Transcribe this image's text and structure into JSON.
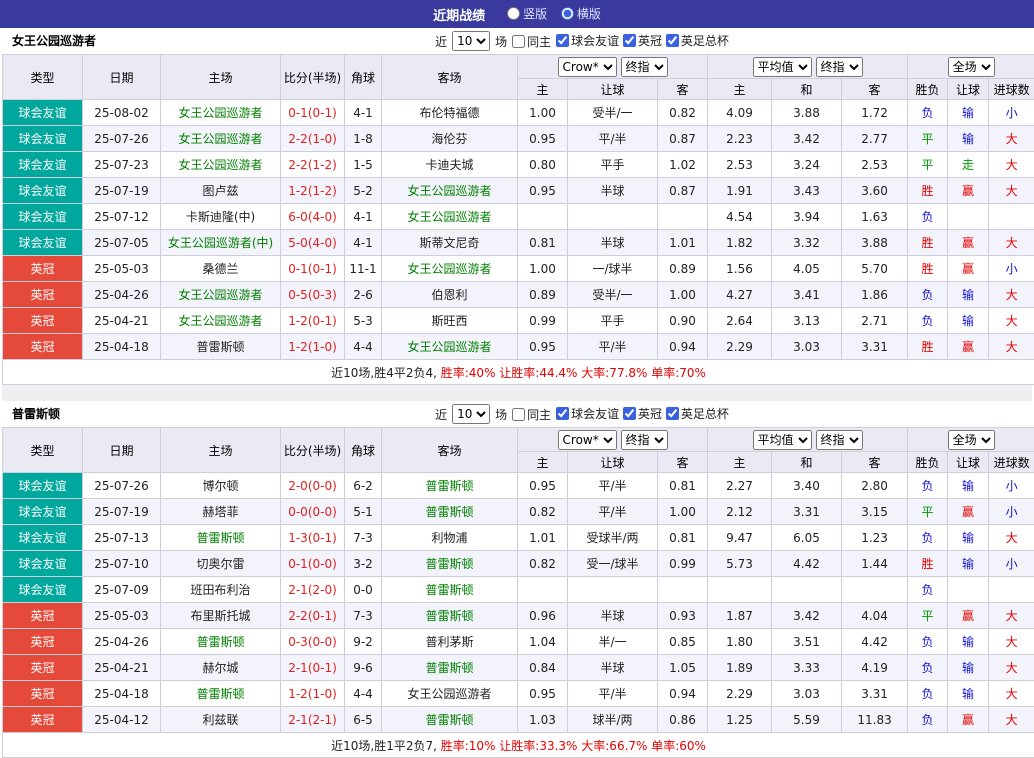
{
  "topbar": {
    "title": "近期战绩",
    "radios": [
      {
        "label": "竖版",
        "checked": false
      },
      {
        "label": "横版",
        "checked": true
      }
    ]
  },
  "filter": {
    "near": "近",
    "count": "10",
    "matches": "场",
    "same_home": "同主",
    "same_home_checked": false,
    "leagues": [
      {
        "label": "球会友谊",
        "checked": true
      },
      {
        "label": "英冠",
        "checked": true
      },
      {
        "label": "英足总杯",
        "checked": true
      }
    ]
  },
  "header": {
    "type": "类型",
    "date": "日期",
    "home": "主场",
    "score": "比分(半场)",
    "corner": "角球",
    "away": "客场",
    "odds_source": "Crow*",
    "odds_kind": "终指",
    "avg_source": "平均值",
    "avg_kind": "终指",
    "full_source": "全场",
    "sub": [
      "主",
      "让球",
      "客",
      "主",
      "和",
      "客",
      "胜负",
      "让球",
      "进球数"
    ]
  },
  "colors": {
    "topbar_bg": "#3A3A9E",
    "friendly_badge": "#00A79D",
    "league_badge": "#E5493A",
    "focal_team": "#008000",
    "win": "#E60000",
    "loss": "#1414CC",
    "draw": "#009900"
  },
  "sections": [
    {
      "team": "女王公园巡游者",
      "rows": [
        {
          "type": "球会友谊",
          "type_key": "friendly",
          "date": "25-08-02",
          "home": "女王公园巡游者",
          "home_key": "focal",
          "score": "0-1(0-1)",
          "corners": "4-1",
          "away": "布伦特福德",
          "away_key": "",
          "odds_home": "1.00",
          "handicap": "受半/一",
          "odds_away": "0.82",
          "avg_home": "4.09",
          "avg_draw": "3.88",
          "avg_away": "1.72",
          "result": "负",
          "result_color": "blue",
          "handicap_result": "输",
          "handicap_color": "blue",
          "goals_result": "小",
          "goals_color": "blue"
        },
        {
          "type": "球会友谊",
          "type_key": "friendly",
          "date": "25-07-26",
          "home": "女王公园巡游者",
          "home_key": "focal",
          "score": "2-2(1-0)",
          "corners": "1-8",
          "away": "海伦芬",
          "away_key": "",
          "odds_home": "0.95",
          "handicap": "平/半",
          "odds_away": "0.87",
          "avg_home": "2.23",
          "avg_draw": "3.42",
          "avg_away": "2.77",
          "result": "平",
          "result_color": "green",
          "handicap_result": "输",
          "handicap_color": "blue",
          "goals_result": "大",
          "goals_color": "red"
        },
        {
          "type": "球会友谊",
          "type_key": "friendly",
          "date": "25-07-23",
          "home": "女王公园巡游者",
          "home_key": "focal",
          "score": "2-2(1-2)",
          "corners": "1-5",
          "away": "卡迪夫城",
          "away_key": "",
          "odds_home": "0.80",
          "handicap": "平手",
          "odds_away": "1.02",
          "avg_home": "2.53",
          "avg_draw": "3.24",
          "avg_away": "2.53",
          "result": "平",
          "result_color": "green",
          "handicap_result": "走",
          "handicap_color": "green",
          "goals_result": "大",
          "goals_color": "red"
        },
        {
          "type": "球会友谊",
          "type_key": "friendly",
          "date": "25-07-19",
          "home": "图卢兹",
          "home_key": "",
          "score": "1-2(1-2)",
          "corners": "5-2",
          "away": "女王公园巡游者",
          "away_key": "focal",
          "odds_home": "0.95",
          "handicap": "半球",
          "odds_away": "0.87",
          "avg_home": "1.91",
          "avg_draw": "3.43",
          "avg_away": "3.60",
          "result": "胜",
          "result_color": "red",
          "handicap_result": "赢",
          "handicap_color": "red",
          "goals_result": "大",
          "goals_color": "red"
        },
        {
          "type": "球会友谊",
          "type_key": "friendly",
          "date": "25-07-12",
          "home": "卡斯迪隆(中)",
          "home_key": "",
          "score": "6-0(4-0)",
          "corners": "4-1",
          "away": "女王公园巡游者",
          "away_key": "focal",
          "odds_home": "",
          "handicap": "",
          "odds_away": "",
          "avg_home": "4.54",
          "avg_draw": "3.94",
          "avg_away": "1.63",
          "result": "负",
          "result_color": "blue",
          "handicap_result": "",
          "handicap_color": "",
          "goals_result": "",
          "goals_color": ""
        },
        {
          "type": "球会友谊",
          "type_key": "friendly",
          "date": "25-07-05",
          "home": "女王公园巡游者(中)",
          "home_key": "focal",
          "score": "5-0(4-0)",
          "corners": "4-1",
          "away": "斯蒂文尼奇",
          "away_key": "",
          "odds_home": "0.81",
          "handicap": "半球",
          "odds_away": "1.01",
          "avg_home": "1.82",
          "avg_draw": "3.32",
          "avg_away": "3.88",
          "result": "胜",
          "result_color": "red",
          "handicap_result": "赢",
          "handicap_color": "red",
          "goals_result": "大",
          "goals_color": "red"
        },
        {
          "type": "英冠",
          "type_key": "league",
          "date": "25-05-03",
          "home": "桑德兰",
          "home_key": "",
          "score": "0-1(0-1)",
          "corners": "11-1",
          "away": "女王公园巡游者",
          "away_key": "focal",
          "odds_home": "1.00",
          "handicap": "一/球半",
          "odds_away": "0.89",
          "avg_home": "1.56",
          "avg_draw": "4.05",
          "avg_away": "5.70",
          "result": "胜",
          "result_color": "red",
          "handicap_result": "赢",
          "handicap_color": "red",
          "goals_result": "小",
          "goals_color": "blue"
        },
        {
          "type": "英冠",
          "type_key": "league",
          "date": "25-04-26",
          "home": "女王公园巡游者",
          "home_key": "focal",
          "score": "0-5(0-3)",
          "corners": "2-6",
          "away": "伯恩利",
          "away_key": "",
          "odds_home": "0.89",
          "handicap": "受半/一",
          "odds_away": "1.00",
          "avg_home": "4.27",
          "avg_draw": "3.41",
          "avg_away": "1.86",
          "result": "负",
          "result_color": "blue",
          "handicap_result": "输",
          "handicap_color": "blue",
          "goals_result": "大",
          "goals_color": "red"
        },
        {
          "type": "英冠",
          "type_key": "league",
          "date": "25-04-21",
          "home": "女王公园巡游者",
          "home_key": "focal",
          "score": "1-2(0-1)",
          "corners": "5-3",
          "away": "斯旺西",
          "away_key": "",
          "odds_home": "0.99",
          "handicap": "平手",
          "odds_away": "0.90",
          "avg_home": "2.64",
          "avg_draw": "3.13",
          "avg_away": "2.71",
          "result": "负",
          "result_color": "blue",
          "handicap_result": "输",
          "handicap_color": "blue",
          "goals_result": "大",
          "goals_color": "red"
        },
        {
          "type": "英冠",
          "type_key": "league",
          "date": "25-04-18",
          "home": "普雷斯顿",
          "home_key": "",
          "score": "1-2(1-0)",
          "corners": "4-4",
          "away": "女王公园巡游者",
          "away_key": "focal",
          "odds_home": "0.95",
          "handicap": "平/半",
          "odds_away": "0.94",
          "avg_home": "2.29",
          "avg_draw": "3.03",
          "avg_away": "3.31",
          "result": "胜",
          "result_color": "red",
          "handicap_result": "赢",
          "handicap_color": "red",
          "goals_result": "大",
          "goals_color": "red"
        }
      ],
      "summary": {
        "record": "近10场,胜4平2负4,",
        "stats": " 胜率:40% 让胜率:44.4% 大率:77.8% 单率:70%"
      }
    },
    {
      "team": "普雷斯顿",
      "rows": [
        {
          "type": "球会友谊",
          "type_key": "friendly",
          "date": "25-07-26",
          "home": "博尔顿",
          "home_key": "",
          "score": "2-0(0-0)",
          "corners": "6-2",
          "away": "普雷斯顿",
          "away_key": "focal",
          "odds_home": "0.95",
          "handicap": "平/半",
          "odds_away": "0.81",
          "avg_home": "2.27",
          "avg_draw": "3.40",
          "avg_away": "2.80",
          "result": "负",
          "result_color": "blue",
          "handicap_result": "输",
          "handicap_color": "blue",
          "goals_result": "小",
          "goals_color": "blue"
        },
        {
          "type": "球会友谊",
          "type_key": "friendly",
          "date": "25-07-19",
          "home": "赫塔菲",
          "home_key": "",
          "score": "0-0(0-0)",
          "corners": "5-1",
          "away": "普雷斯顿",
          "away_key": "focal",
          "odds_home": "0.82",
          "handicap": "平/半",
          "odds_away": "1.00",
          "avg_home": "2.12",
          "avg_draw": "3.31",
          "avg_away": "3.15",
          "result": "平",
          "result_color": "green",
          "handicap_result": "赢",
          "handicap_color": "red",
          "goals_result": "小",
          "goals_color": "blue"
        },
        {
          "type": "球会友谊",
          "type_key": "friendly",
          "date": "25-07-13",
          "home": "普雷斯顿",
          "home_key": "focal",
          "score": "1-3(0-1)",
          "corners": "7-3",
          "away": "利物浦",
          "away_key": "",
          "odds_home": "1.01",
          "handicap": "受球半/两",
          "odds_away": "0.81",
          "avg_home": "9.47",
          "avg_draw": "6.05",
          "avg_away": "1.23",
          "result": "负",
          "result_color": "blue",
          "handicap_result": "输",
          "handicap_color": "blue",
          "goals_result": "大",
          "goals_color": "red"
        },
        {
          "type": "球会友谊",
          "type_key": "friendly",
          "date": "25-07-10",
          "home": "切奥尔雷",
          "home_key": "",
          "score": "0-1(0-0)",
          "corners": "3-2",
          "away": "普雷斯顿",
          "away_key": "focal",
          "odds_home": "0.82",
          "handicap": "受一/球半",
          "odds_away": "0.99",
          "avg_home": "5.73",
          "avg_draw": "4.42",
          "avg_away": "1.44",
          "result": "胜",
          "result_color": "red",
          "handicap_result": "输",
          "handicap_color": "blue",
          "goals_result": "小",
          "goals_color": "blue"
        },
        {
          "type": "球会友谊",
          "type_key": "friendly",
          "date": "25-07-09",
          "home": "班田布利治",
          "home_key": "",
          "score": "2-1(2-0)",
          "corners": "0-0",
          "away": "普雷斯顿",
          "away_key": "focal",
          "odds_home": "",
          "handicap": "",
          "odds_away": "",
          "avg_home": "",
          "avg_draw": "",
          "avg_away": "",
          "result": "负",
          "result_color": "blue",
          "handicap_result": "",
          "handicap_color": "",
          "goals_result": "",
          "goals_color": ""
        },
        {
          "type": "英冠",
          "type_key": "league",
          "date": "25-05-03",
          "home": "布里斯托城",
          "home_key": "",
          "score": "2-2(0-1)",
          "corners": "7-3",
          "away": "普雷斯顿",
          "away_key": "focal",
          "odds_home": "0.96",
          "handicap": "半球",
          "odds_away": "0.93",
          "avg_home": "1.87",
          "avg_draw": "3.42",
          "avg_away": "4.04",
          "result": "平",
          "result_color": "green",
          "handicap_result": "赢",
          "handicap_color": "red",
          "goals_result": "大",
          "goals_color": "red"
        },
        {
          "type": "英冠",
          "type_key": "league",
          "date": "25-04-26",
          "home": "普雷斯顿",
          "home_key": "focal",
          "score": "0-3(0-0)",
          "corners": "9-2",
          "away": "普利茅斯",
          "away_key": "",
          "odds_home": "1.04",
          "handicap": "半/一",
          "odds_away": "0.85",
          "avg_home": "1.80",
          "avg_draw": "3.51",
          "avg_away": "4.42",
          "result": "负",
          "result_color": "blue",
          "handicap_result": "输",
          "handicap_color": "blue",
          "goals_result": "大",
          "goals_color": "red"
        },
        {
          "type": "英冠",
          "type_key": "league",
          "date": "25-04-21",
          "home": "赫尔城",
          "home_key": "",
          "score": "2-1(0-1)",
          "corners": "9-6",
          "away": "普雷斯顿",
          "away_key": "focal",
          "odds_home": "0.84",
          "handicap": "半球",
          "odds_away": "1.05",
          "avg_home": "1.89",
          "avg_draw": "3.33",
          "avg_away": "4.19",
          "result": "负",
          "result_color": "blue",
          "handicap_result": "输",
          "handicap_color": "blue",
          "goals_result": "大",
          "goals_color": "red"
        },
        {
          "type": "英冠",
          "type_key": "league",
          "date": "25-04-18",
          "home": "普雷斯顿",
          "home_key": "focal",
          "score": "1-2(1-0)",
          "corners": "4-4",
          "away": "女王公园巡游者",
          "away_key": "",
          "odds_home": "0.95",
          "handicap": "平/半",
          "odds_away": "0.94",
          "avg_home": "2.29",
          "avg_draw": "3.03",
          "avg_away": "3.31",
          "result": "负",
          "result_color": "blue",
          "handicap_result": "输",
          "handicap_color": "blue",
          "goals_result": "大",
          "goals_color": "red"
        },
        {
          "type": "英冠",
          "type_key": "league",
          "date": "25-04-12",
          "home": "利兹联",
          "home_key": "",
          "score": "2-1(2-1)",
          "corners": "6-5",
          "away": "普雷斯顿",
          "away_key": "focal",
          "odds_home": "1.03",
          "handicap": "球半/两",
          "odds_away": "0.86",
          "avg_home": "1.25",
          "avg_draw": "5.59",
          "avg_away": "11.83",
          "result": "负",
          "result_color": "blue",
          "handicap_result": "赢",
          "handicap_color": "red",
          "goals_result": "大",
          "goals_color": "red"
        }
      ],
      "summary": {
        "record": "近10场,胜1平2负7,",
        "stats": " 胜率:10% 让胜率:33.3% 大率:66.7% 单率:60%"
      }
    }
  ]
}
